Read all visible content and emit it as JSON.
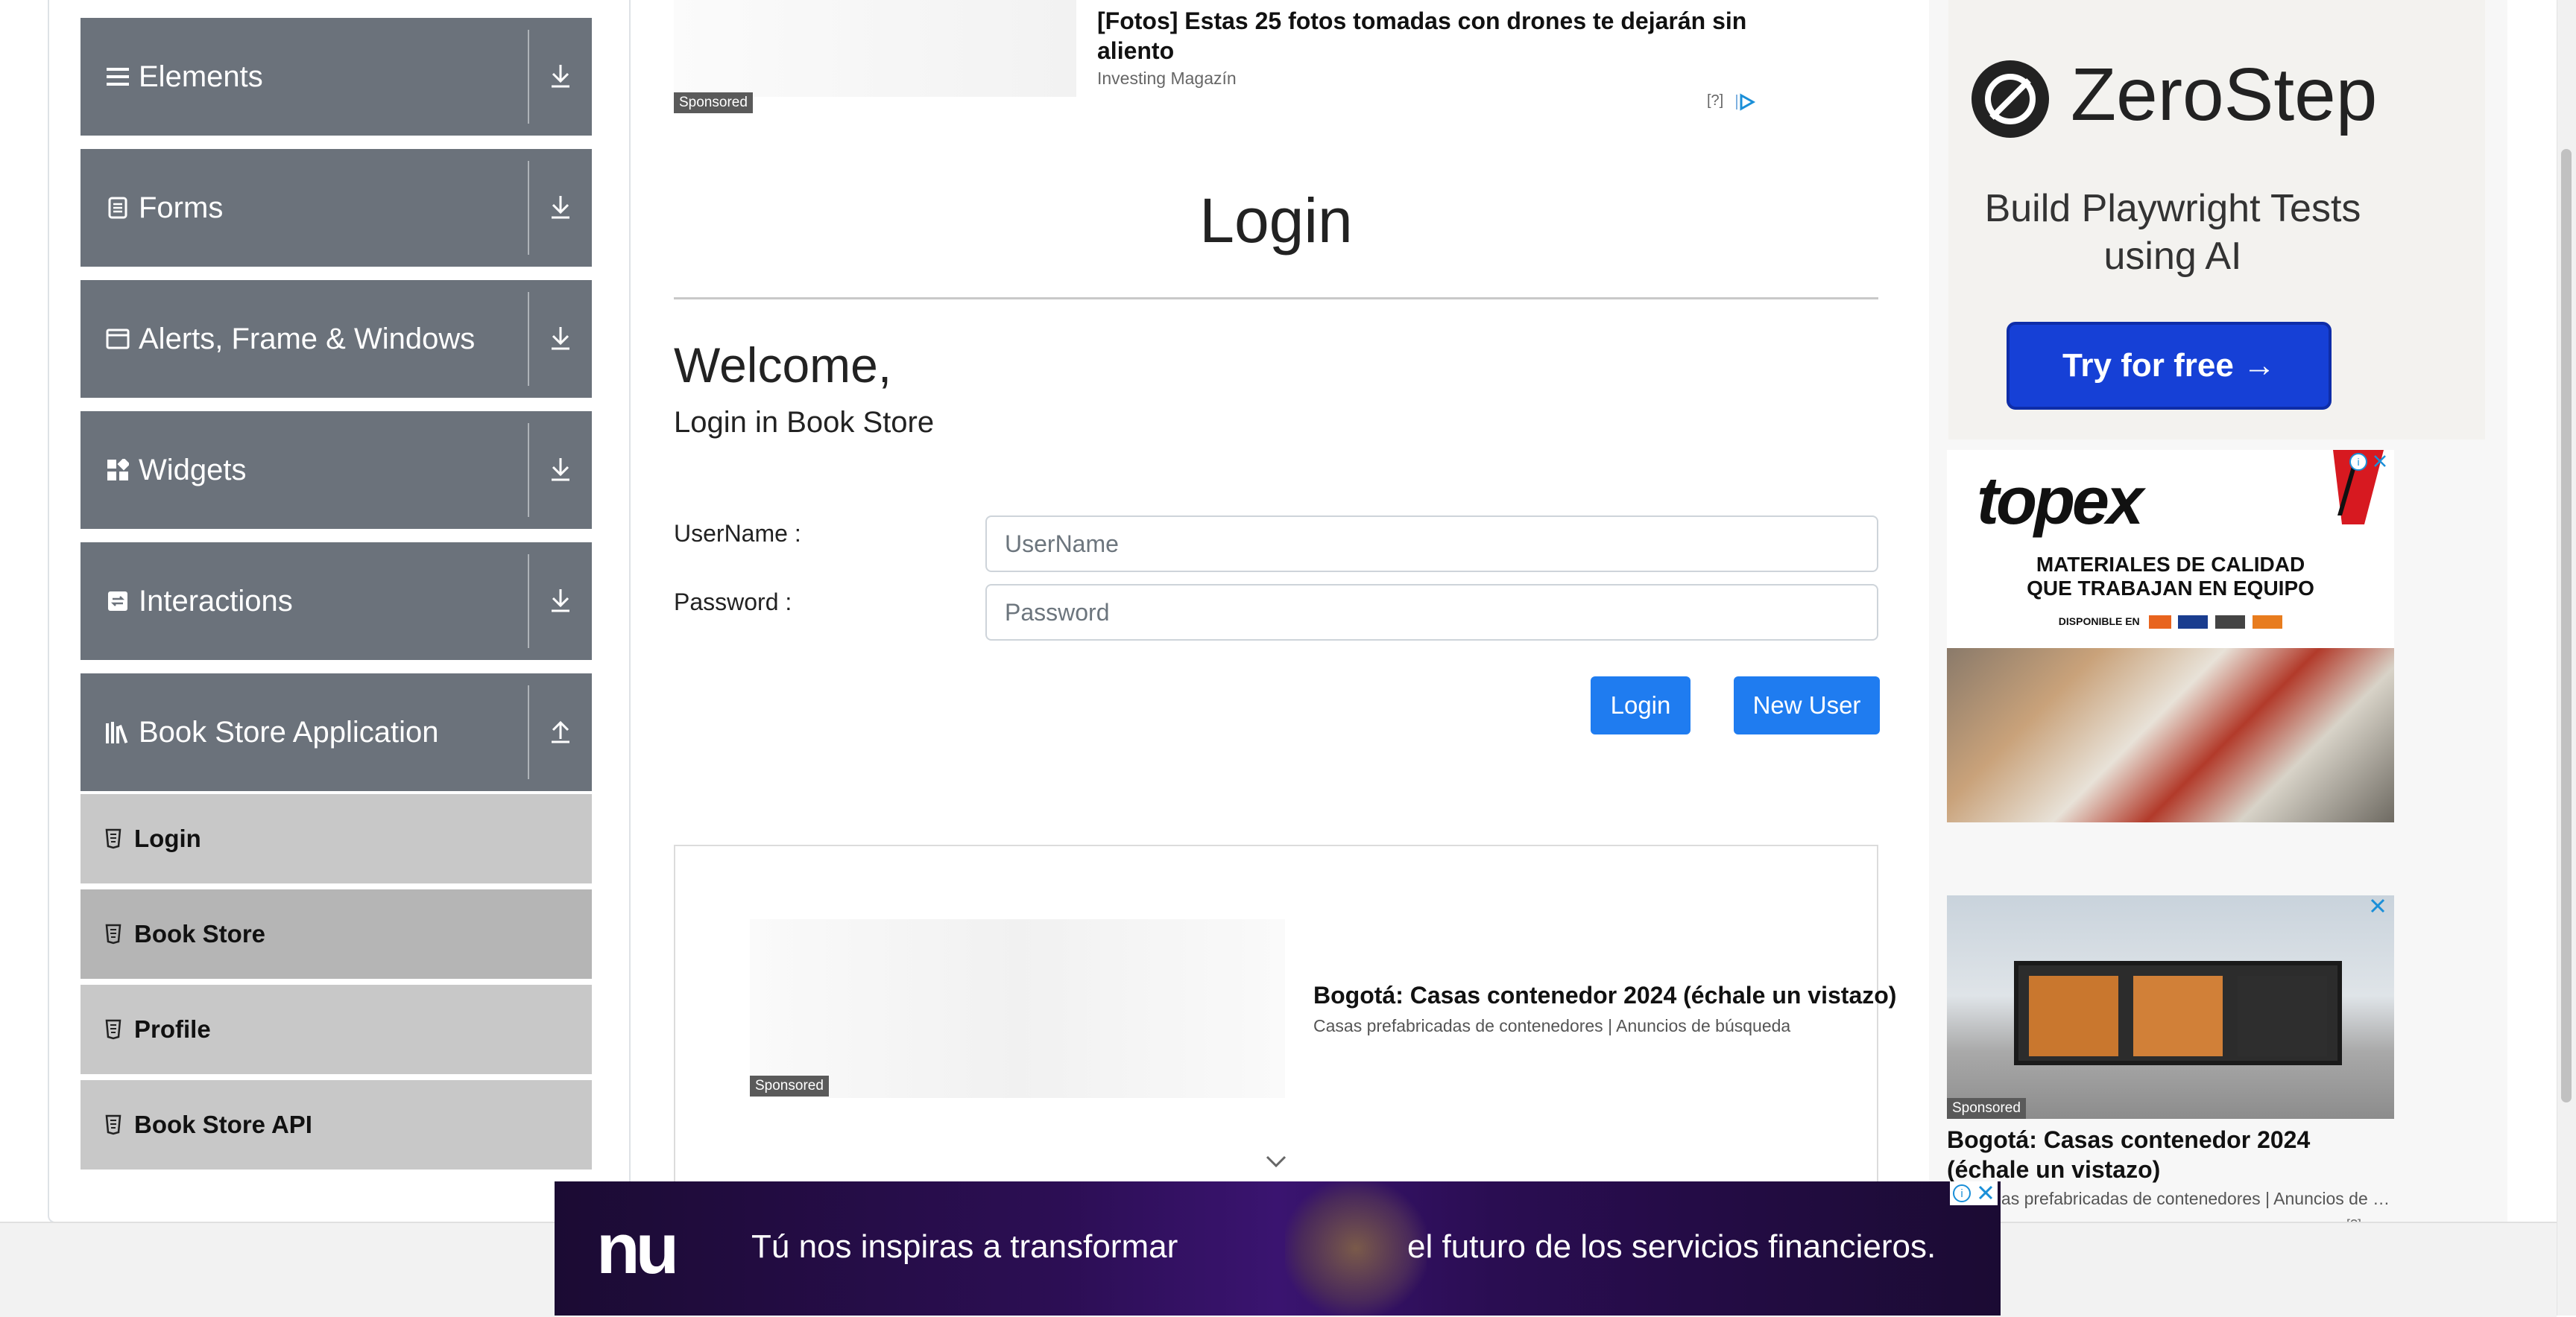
{
  "sidebar": {
    "groups": [
      {
        "label": "Elements",
        "icon": "hamburger-icon"
      },
      {
        "label": "Forms",
        "icon": "document-icon"
      },
      {
        "label": "Alerts, Frame & Windows",
        "icon": "window-icon"
      },
      {
        "label": "Widgets",
        "icon": "widgets-icon"
      },
      {
        "label": "Interactions",
        "icon": "interactions-icon"
      },
      {
        "label": "Book Store Application",
        "icon": "books-icon"
      }
    ],
    "items": [
      {
        "label": "Login"
      },
      {
        "label": "Book Store"
      },
      {
        "label": "Profile"
      },
      {
        "label": "Book Store API"
      }
    ]
  },
  "top_ad": {
    "title": "[Fotos] Estas 25 fotos tomadas con drones te dejarán sin aliento",
    "source": "Investing Magazín",
    "sponsored": "Sponsored",
    "info": "[?]"
  },
  "main": {
    "page_title": "Login",
    "welcome": "Welcome,",
    "subtitle": "Login in Book Store",
    "username_label": "UserName :",
    "username_placeholder": "UserName",
    "password_label": "Password :",
    "password_placeholder": "Password",
    "login_button": "Login",
    "new_user_button": "New User"
  },
  "mid_ad": {
    "title": "Bogotá: Casas contenedor 2024 (échale un vistazo)",
    "source": "Casas prefabricadas de contenedores | Anuncios de búsqueda",
    "sponsored": "Sponsored"
  },
  "right_ads": {
    "zerostep_name": "ZeroStep",
    "zerostep_tagline": "Build Playwright Tests using AI",
    "zerostep_button": "Try for free →",
    "topex_logo": "topex",
    "topex_line1": "MATERIALES DE CALIDAD",
    "topex_line2": "QUE TRABAJAN EN EQUIPO",
    "topex_line3": "DISPONIBLE EN",
    "house_sponsored": "Sponsored",
    "house_title": "Bogotá: Casas contenedor 2024 (échale un vistazo)",
    "house_source": "Casas prefabricadas de contenedores | Anuncios de búsqueda",
    "house_info": "[?]"
  },
  "bottom_banner": {
    "logo": "nu",
    "text_left": "Tú nos inspiras a transformar",
    "text_right": "el futuro de los servicios financieros."
  },
  "colors": {
    "sidebar_header": "#6b727b",
    "sidebar_item": "#c8c8c8",
    "sidebar_item_active": "#b5b5b5",
    "primary_button": "#1f7cf0",
    "zerostep_button": "#1640d6",
    "banner_bg": "#2c0e54"
  }
}
